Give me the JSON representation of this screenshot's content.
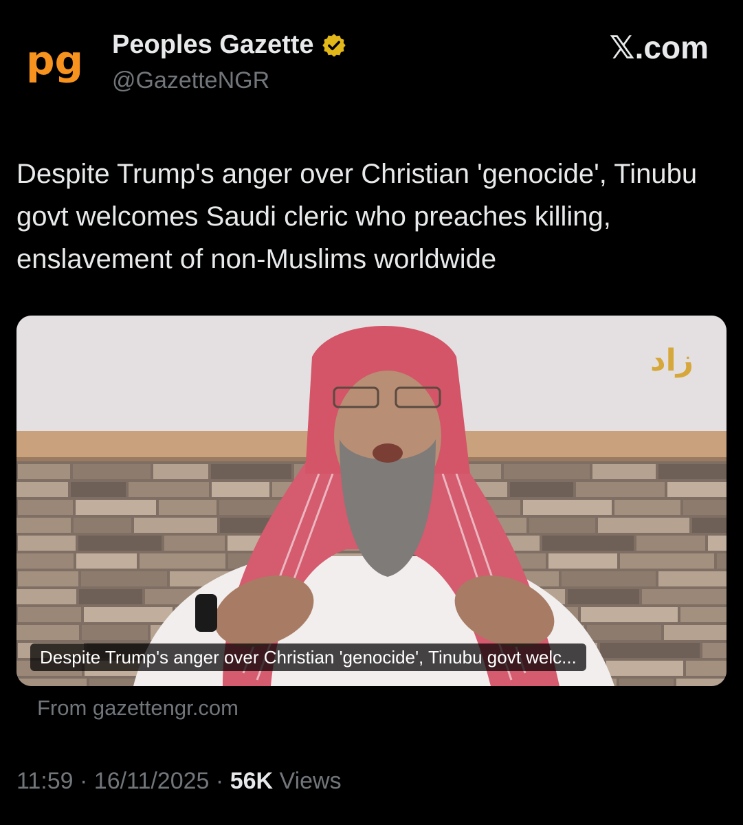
{
  "author": {
    "display_name": "Peoples Gazette",
    "handle": "@GazetteNGR",
    "avatar_text": "pg"
  },
  "brand": "𝕏.com",
  "tweet": {
    "text": "Despite Trump's anger over Christian 'genocide', Tinubu govt welcomes Saudi cleric who preaches killing, enslavement of non-Muslims worldwide"
  },
  "card": {
    "caption": "Despite Trump's anger over Christian 'genocide', Tinubu govt welc...",
    "source": "From gazettengr.com",
    "channel_logo": "زاد"
  },
  "meta": {
    "time": "11:59",
    "separator": "·",
    "date": "16/11/2025",
    "views_count": "56K",
    "views_label": "Views"
  },
  "colors": {
    "background": "#000000",
    "text_primary": "#e7e9ea",
    "text_secondary": "#71767b",
    "avatar_orange": "#f7921e",
    "verified_gold": "#e2b719"
  },
  "icons": {
    "verified": "verified-badge-icon"
  }
}
